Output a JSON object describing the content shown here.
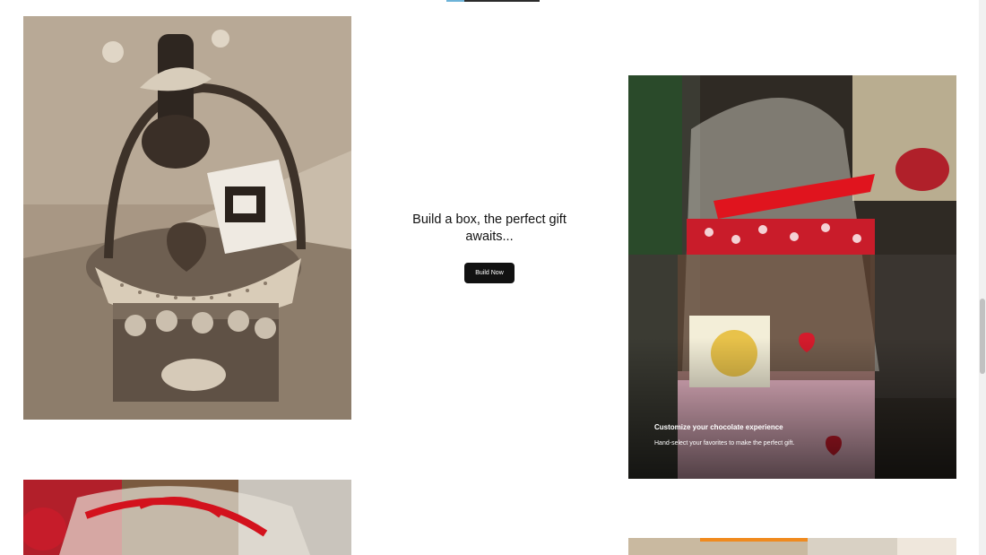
{
  "cta": {
    "heading": "Build a box, the perfect gift awaits...",
    "button_label": "Build Now"
  },
  "feature_card": {
    "title": "Customize your chocolate experience",
    "subtitle": "Hand-select your favorites to make the perfect gift."
  },
  "photos": {
    "sepia_alt": "Gift basket with chocolates",
    "color_alt": "Valentine chocolate box wrapped in cellophane",
    "bottom_left_alt": "Gift basket with red ribbon",
    "bottom_right_alt": "Chocolate gift box"
  },
  "colors": {
    "button_bg": "#111111",
    "button_text": "#ffffff",
    "heading_text": "#111111"
  }
}
